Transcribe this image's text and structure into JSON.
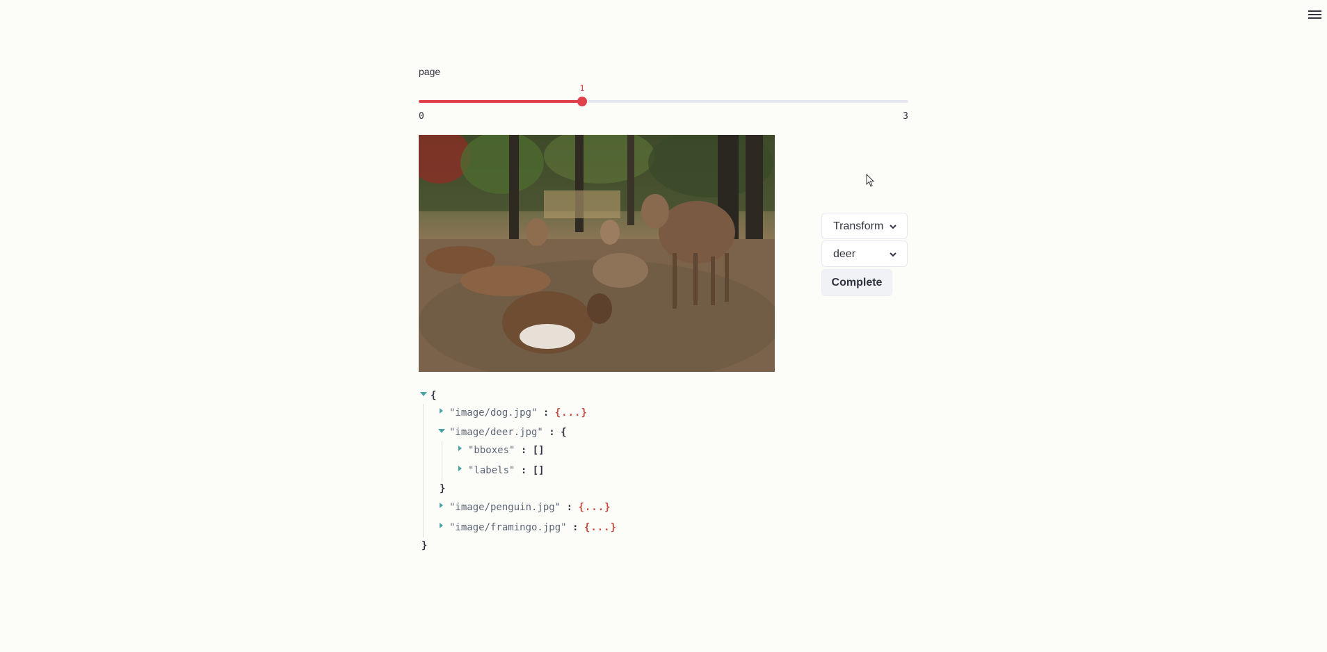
{
  "header": {
    "menu_icon": "hamburger-menu-icon"
  },
  "slider": {
    "label": "page",
    "min": 0,
    "max": 3,
    "value": 1,
    "min_label": "0",
    "max_label": "3",
    "value_label": "1",
    "accent_color": "#e0404a"
  },
  "image": {
    "alt": "deer"
  },
  "controls": {
    "transform_select": "Transform",
    "class_select": "deer",
    "complete_button": "Complete"
  },
  "json_tree": {
    "open_brace": "{",
    "close_brace": "}",
    "entries": [
      {
        "key": "\"image/dog.jpg\"",
        "sep": ":",
        "value": "{...}",
        "expanded": false
      },
      {
        "key": "\"image/deer.jpg\"",
        "sep": ":",
        "open": "{",
        "close": "}",
        "expanded": true,
        "children": [
          {
            "key": "\"bboxes\"",
            "sep": ":",
            "value": "[]"
          },
          {
            "key": "\"labels\"",
            "sep": ":",
            "value": "[]"
          }
        ]
      },
      {
        "key": "\"image/penguin.jpg\"",
        "sep": ":",
        "value": "{...}",
        "expanded": false
      },
      {
        "key": "\"image/framingo.jpg\"",
        "sep": ":",
        "value": "{...}",
        "expanded": false
      }
    ]
  }
}
